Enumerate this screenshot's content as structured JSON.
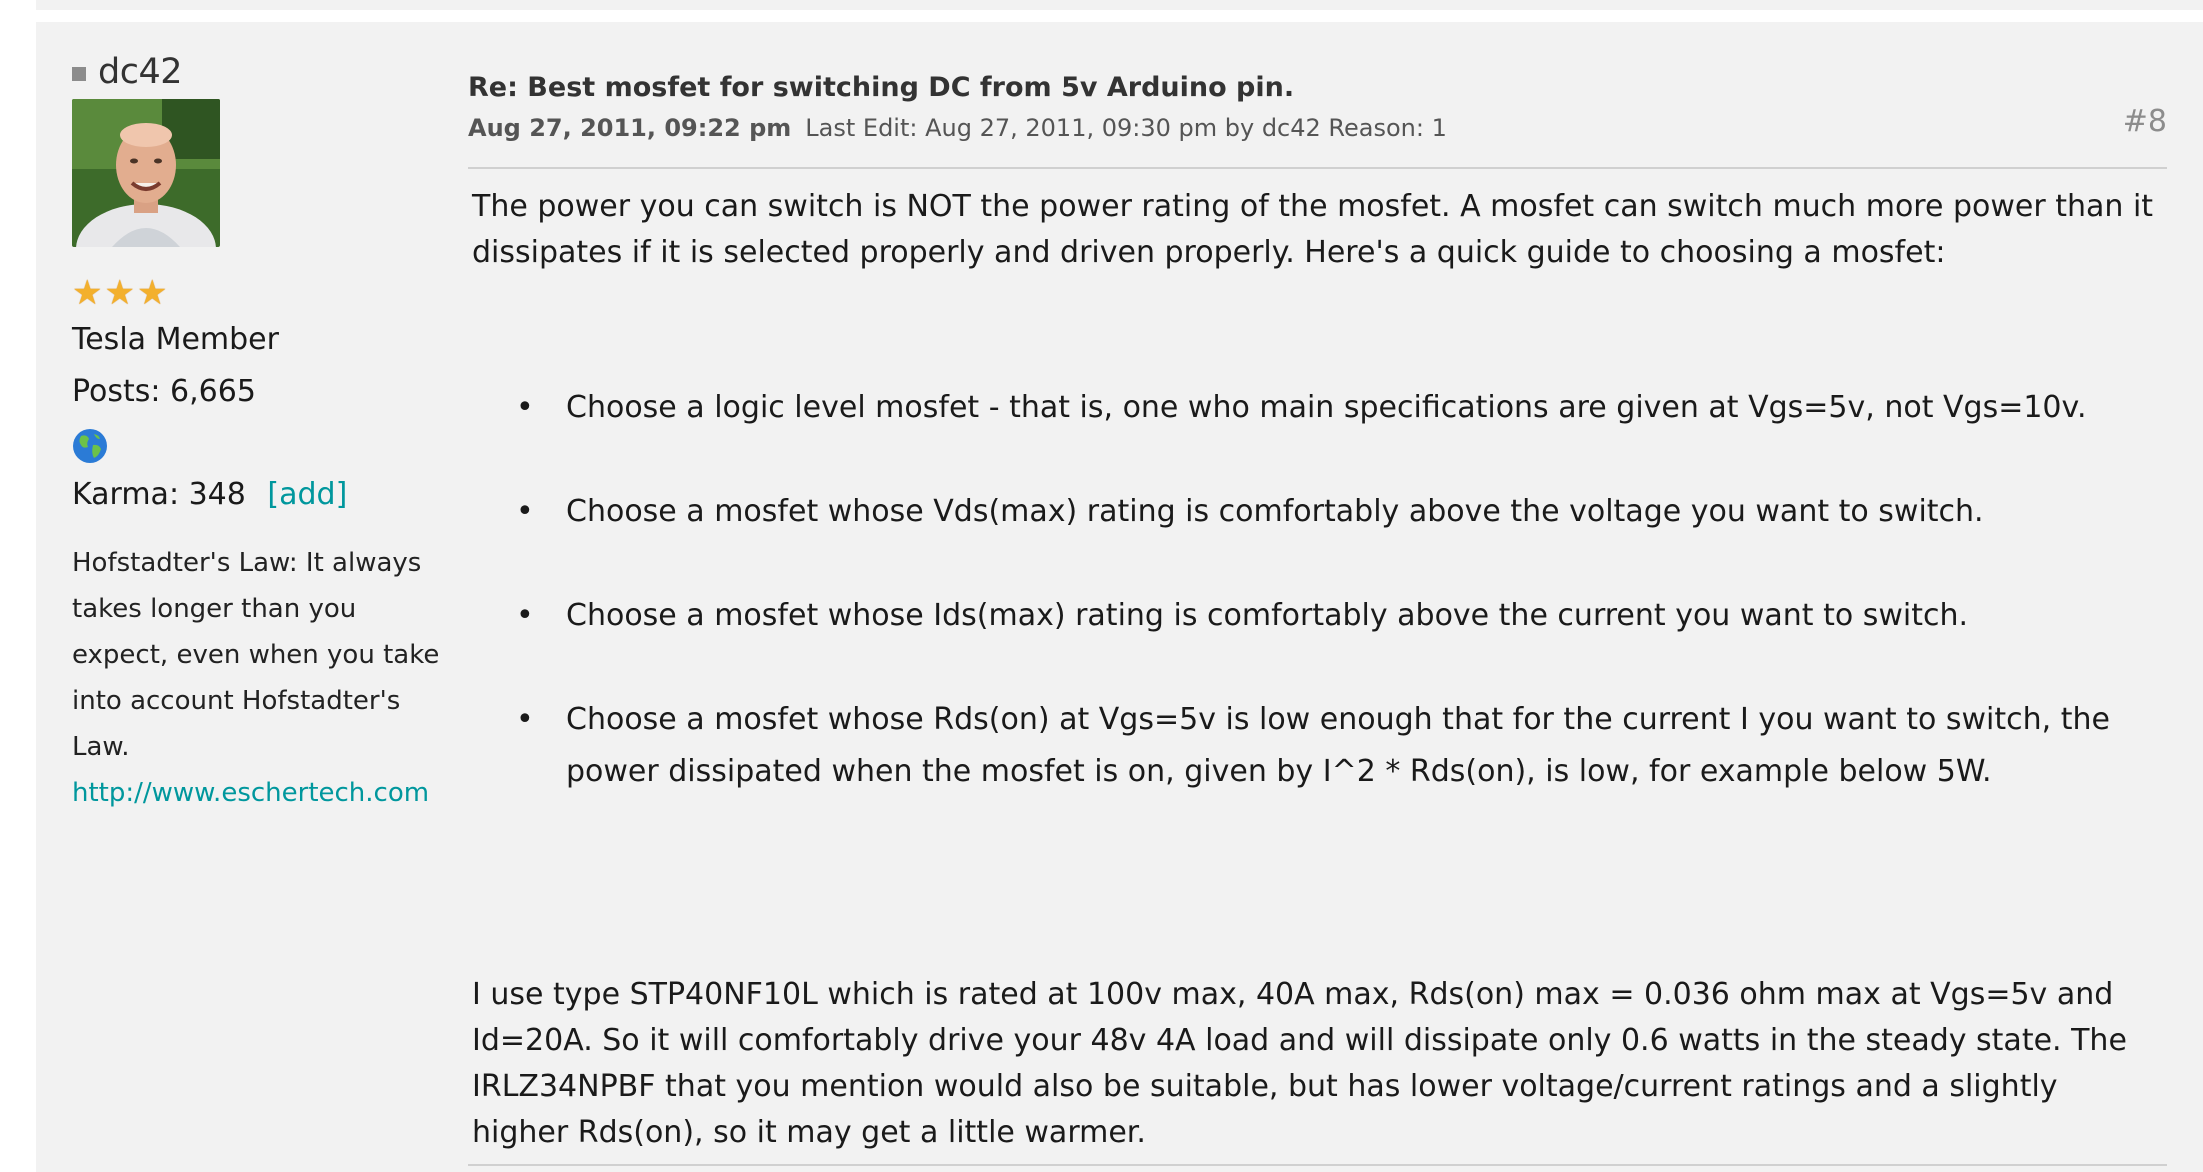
{
  "poster": {
    "name": "dc42",
    "rank": "Tesla Member",
    "posts": "Posts: 6,665",
    "karma": "Karma: 348",
    "karma_add": "[add]",
    "signature": "Hofstadter's Law: It always takes longer than you expect, even when you take into account Hofstadter's Law.",
    "signature_link": "http://www.eschertech.com",
    "stars": 3,
    "icons": {
      "status": "status-square-icon",
      "star": "star-icon",
      "globe": "globe-icon"
    }
  },
  "post": {
    "title": "Re: Best mosfet for switching DC from 5v Arduino pin.",
    "date": "Aug 27, 2011, 09:22 pm",
    "last_edit": "Last Edit: Aug 27, 2011, 09:30 pm by dc42 Reason: 1",
    "number": "#8",
    "intro": "The power you can switch is NOT the power rating of the mosfet. A mosfet can switch much more power than it dissipates if it is selected properly and driven properly. Here's a quick guide to choosing a mosfet:",
    "bullets": [
      "Choose a logic level mosfet - that is, one who main specifications are given at Vgs=5v, not Vgs=10v.",
      "Choose a mosfet whose Vds(max) rating is comfortably above the voltage you want to switch.",
      "Choose a mosfet whose Ids(max) rating is comfortably above the current you want to switch.",
      "Choose a mosfet whose Rds(on) at Vgs=5v is low enough that for the current I you want to switch, the power dissipated when the mosfet is on, given by I^2 * Rds(on), is low, for example below 5W."
    ],
    "closing": "I use type STP40NF10L which is rated at 100v max, 40A max, Rds(on) max = 0.036 ohm max at Vgs=5v and Id=20A. So it will comfortably drive your 48v 4A load and will dissipate only 0.6 watts in the steady state. The IRLZ34NPBF that you mention would also be suitable, but has lower voltage/current ratings  and a slightly higher Rds(on), so it may get a little warmer."
  },
  "colors": {
    "link": "#00979d",
    "panel_bg": "#f2f2f2",
    "star": "#f3b02d"
  }
}
